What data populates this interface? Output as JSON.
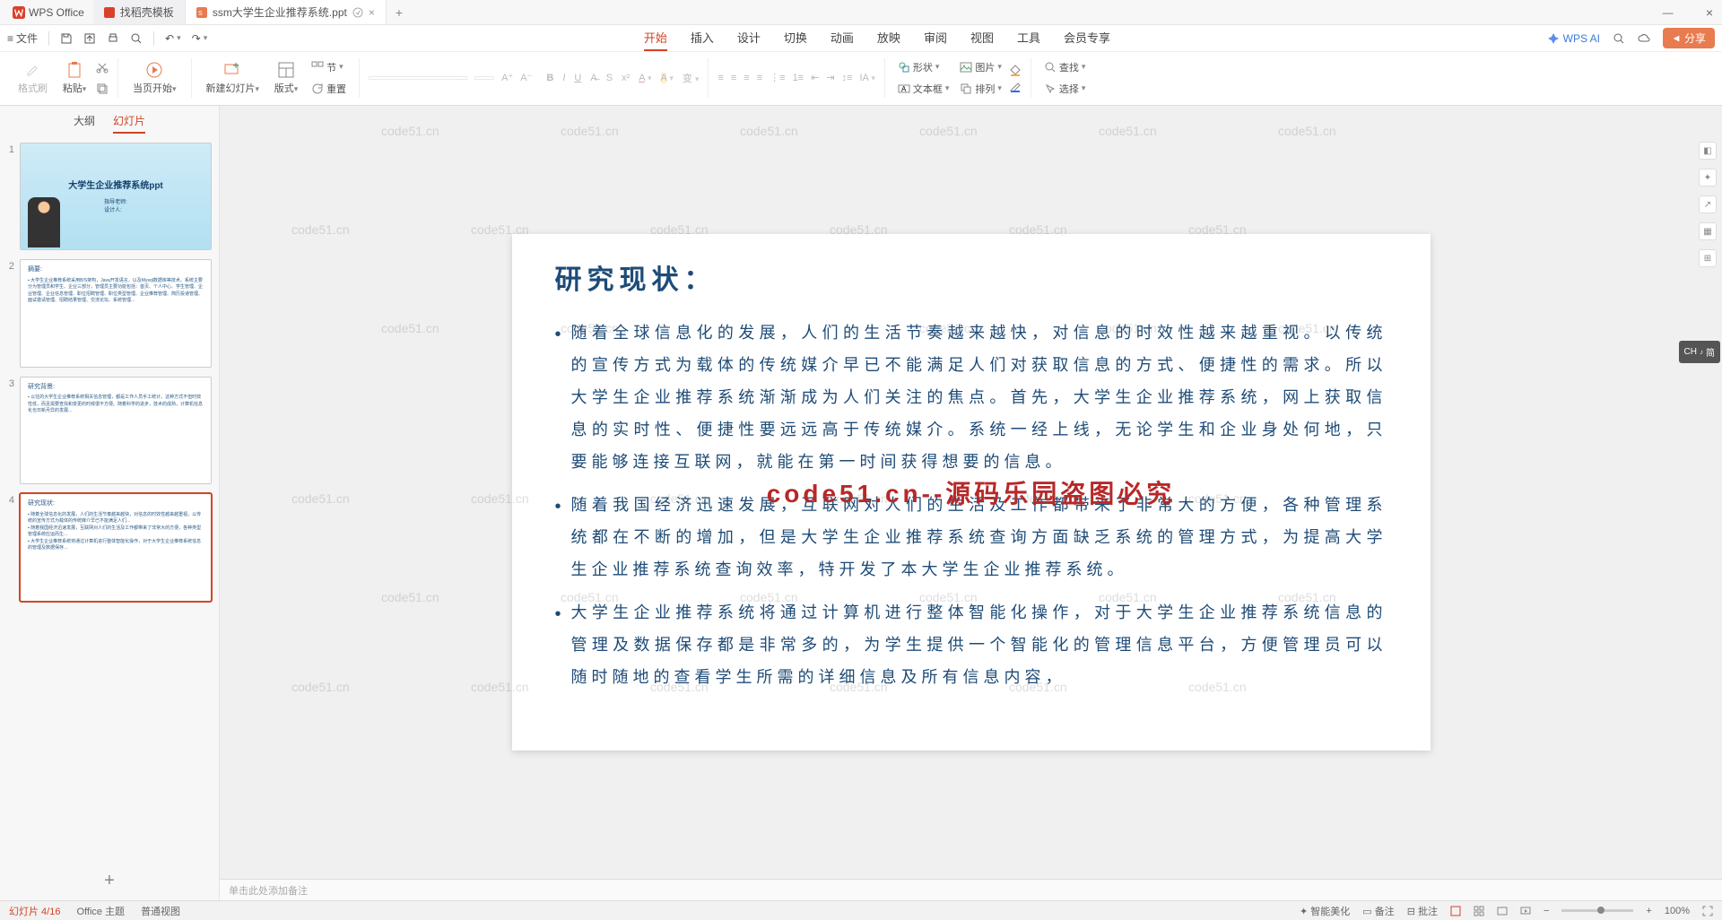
{
  "app": {
    "brand": "WPS Office"
  },
  "titlebar": {
    "tabs": [
      {
        "label": "找稻壳模板"
      },
      {
        "label": "ssm大学生企业推荐系统.ppt"
      }
    ]
  },
  "qat": {
    "file": "文件"
  },
  "menu": {
    "items": [
      "开始",
      "插入",
      "设计",
      "切换",
      "动画",
      "放映",
      "审阅",
      "视图",
      "工具",
      "会员专享"
    ],
    "wps_ai": "WPS AI",
    "share": "分享"
  },
  "ribbon": {
    "format_painter": "格式刷",
    "paste": "粘贴",
    "from_current": "当页开始",
    "new_slide": "新建幻灯片",
    "layout": "版式",
    "section": "节",
    "reset": "重置",
    "shape": "形状",
    "picture": "图片",
    "textbox": "文本框",
    "arrange": "排列",
    "find": "查找",
    "select": "选择"
  },
  "thumb_panel": {
    "tabs": [
      "大纲",
      "幻灯片"
    ]
  },
  "slides": [
    {
      "title": "大学生企业推荐系统ppt",
      "sub1": "指导老师:",
      "sub2": "设计人:"
    },
    {
      "heading": "摘要:"
    },
    {
      "heading": "研究背景:"
    },
    {
      "heading": "研究现状:"
    }
  ],
  "current_slide": {
    "title": "研究现状：",
    "bullets": [
      "随着全球信息化的发展，人们的生活节奏越来越快，对信息的时效性越来越重视。以传统的宣传方式为载体的传统媒介早已不能满足人们对获取信息的方式、便捷性的需求。所以大学生企业推荐系统渐渐成为人们关注的焦点。首先，大学生企业推荐系统，网上获取信息的实时性、便捷性要远远高于传统媒介。系统一经上线，无论学生和企业身处何地，只要能够连接互联网，就能在第一时间获得想要的信息。",
      "随着我国经济迅速发展，互联网对人们的生活及工作都带来了非常大的方便，各种管理系统都在不断的增加，但是大学生企业推荐系统查询方面缺乏系统的管理方式，为提高大学生企业推荐系统查询效率，特开发了本大学生企业推荐系统。",
      "大学生企业推荐系统将通过计算机进行整体智能化操作，对于大学生企业推荐系统信息的管理及数据保存都是非常多的，为学生提供一个智能化的管理信息平台，方便管理员可以随时随地的查看学生所需的详细信息及所有信息内容，"
    ]
  },
  "overlay": {
    "main": "code51.cn--源码乐园盗图必究",
    "repeat": "code51.cn"
  },
  "notes": {
    "placeholder": "单击此处添加备注"
  },
  "status": {
    "left": [
      "幻灯片 4/16",
      "Office 主题",
      "普通视图"
    ],
    "right": [
      "智能美化",
      "备注",
      "批注"
    ]
  },
  "ime": {
    "label": "CH",
    "sub": "简"
  }
}
